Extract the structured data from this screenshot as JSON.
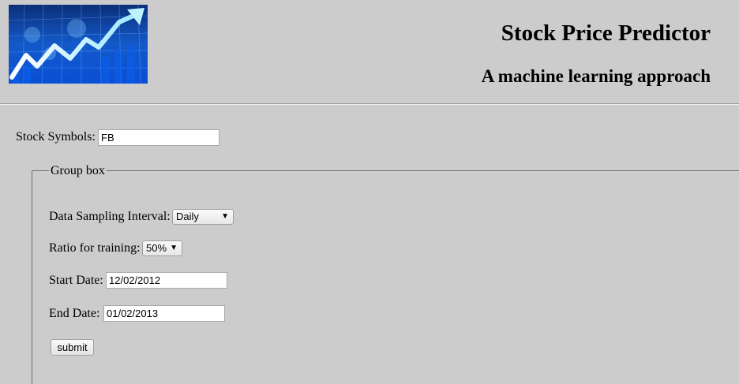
{
  "header": {
    "title": "Stock Price Predictor",
    "subtitle": "A machine learning approach",
    "logo_icon": "stock-chart-rising-arrow"
  },
  "form": {
    "symbols_label": "Stock Symbols:",
    "symbols_value": "FB",
    "group_legend": "Group box",
    "interval_label": "Data Sampling Interval:",
    "interval_value": "Daily",
    "ratio_label": "Ratio for training:",
    "ratio_value": "50%",
    "start_label": "Start Date:",
    "start_value": "12/02/2012",
    "end_label": "End Date:",
    "end_value": "01/02/2013",
    "submit_label": "submit"
  },
  "colors": {
    "page_background": "#cccccc",
    "logo_blue": "#0a3fa8",
    "logo_arrow": "#ffffff"
  }
}
